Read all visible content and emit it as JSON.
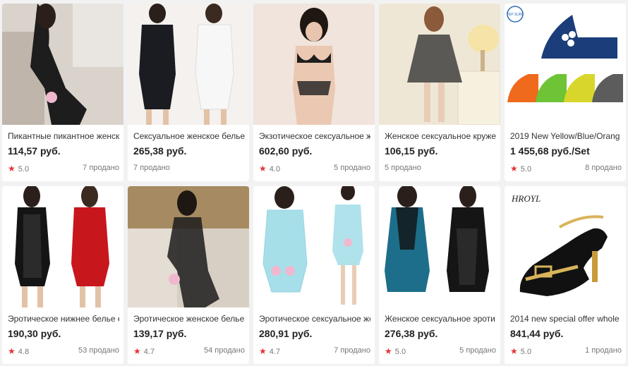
{
  "products": [
    {
      "title": "Пикантные пикантное женск",
      "price": "114,57 руб.",
      "rating": "5.0",
      "sold": "7 продано"
    },
    {
      "title": "Сексуальное женское белье,",
      "price": "265,38 руб.",
      "rating": "",
      "sold": "7 продано"
    },
    {
      "title": "Экзотическое сексуальное ж",
      "price": "602,60 руб.",
      "rating": "4.0",
      "sold": "5 продано"
    },
    {
      "title": "Женское сексуальное кружев",
      "price": "106,15 руб.",
      "rating": "",
      "sold": "5 продано"
    },
    {
      "title": "2019 New Yellow/Blue/Orang",
      "price": "1 455,68 руб./Set",
      "rating": "5.0",
      "sold": "8 продано"
    },
    {
      "title": "Эротическое нижнее белье е",
      "price": "190,30 руб.",
      "rating": "4.8",
      "sold": "53 продано"
    },
    {
      "title": "Эротическое женское белье,",
      "price": "139,17 руб.",
      "rating": "4.7",
      "sold": "54 продано"
    },
    {
      "title": "Эротическое сексуальное же",
      "price": "280,91 руб.",
      "rating": "4.7",
      "sold": "7 продано"
    },
    {
      "title": "Женское сексуальное эроти",
      "price": "276,38 руб.",
      "rating": "5.0",
      "sold": "5 продано"
    },
    {
      "title": "2014 new special offer whole",
      "price": "841,44 руб.",
      "rating": "5.0",
      "sold": "1 продано"
    }
  ],
  "image_labels": {
    "yep_surf_badge": "YEP SURF",
    "hroyl_brand": "HROYL"
  },
  "colors": {
    "rating_star": "#e3343a",
    "card_bg": "#ffffff",
    "page_bg": "#f2f2f2"
  }
}
